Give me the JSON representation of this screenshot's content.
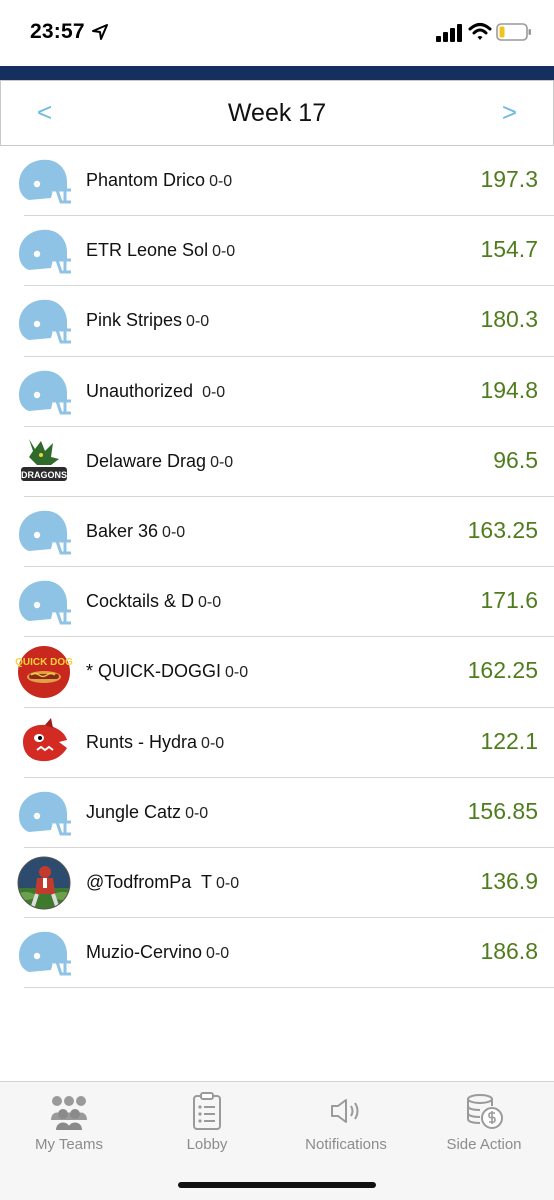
{
  "status": {
    "time": "23:57",
    "icons": [
      "location-arrow-icon",
      "signal-bars-icon",
      "wifi-icon",
      "battery-low-icon"
    ],
    "battery_color": "#f0c419"
  },
  "header": {
    "prev_label": "<",
    "next_label": ">",
    "week_title": "Week 17",
    "bar_color": "#15305f",
    "arrow_color": "#6cb8e6"
  },
  "teams": [
    {
      "name": "Phantom Drico",
      "record": "0-0",
      "score": "197.3",
      "logo": "helmet-icon"
    },
    {
      "name": "ETR Leone Sol",
      "record": "0-0",
      "score": "154.7",
      "logo": "helmet-icon"
    },
    {
      "name": "Pink Stripes",
      "record": "0-0",
      "score": "180.3",
      "logo": "helmet-icon"
    },
    {
      "name": "Unauthorized ",
      "record": "0-0",
      "score": "194.8",
      "logo": "helmet-icon"
    },
    {
      "name": "Delaware Drag",
      "record": "0-0",
      "score": "96.5",
      "logo": "dragons-logo-icon"
    },
    {
      "name": "Baker 36",
      "record": "0-0",
      "score": "163.25",
      "logo": "helmet-icon"
    },
    {
      "name": "Cocktails & D",
      "record": "0-0",
      "score": "171.6",
      "logo": "helmet-icon"
    },
    {
      "name": "* QUICK-DOGGI",
      "record": "0-0",
      "score": "162.25",
      "logo": "quick-dog-logo-icon"
    },
    {
      "name": "Runts - Hydra",
      "record": "0-0",
      "score": "122.1",
      "logo": "red-mascot-logo-icon"
    },
    {
      "name": "Jungle Catz",
      "record": "0-0",
      "score": "156.85",
      "logo": "helmet-icon"
    },
    {
      "name": "@TodfromPa  T",
      "record": "0-0",
      "score": "136.9",
      "logo": "football-player-avatar-icon"
    },
    {
      "name": "Muzio-Cervino",
      "record": "0-0",
      "score": "186.8",
      "logo": "helmet-icon"
    }
  ],
  "logo_text": {
    "quick_dog": "QUICK DOG",
    "dragons": "DRAGONS"
  },
  "score_color": "#4f7d1d",
  "tabs": [
    {
      "label": "My Teams",
      "icon": "people-group-icon"
    },
    {
      "label": "Lobby",
      "icon": "clipboard-list-icon"
    },
    {
      "label": "Notifications",
      "icon": "speaker-icon"
    },
    {
      "label": "Side Action",
      "icon": "coins-dollar-icon"
    }
  ]
}
